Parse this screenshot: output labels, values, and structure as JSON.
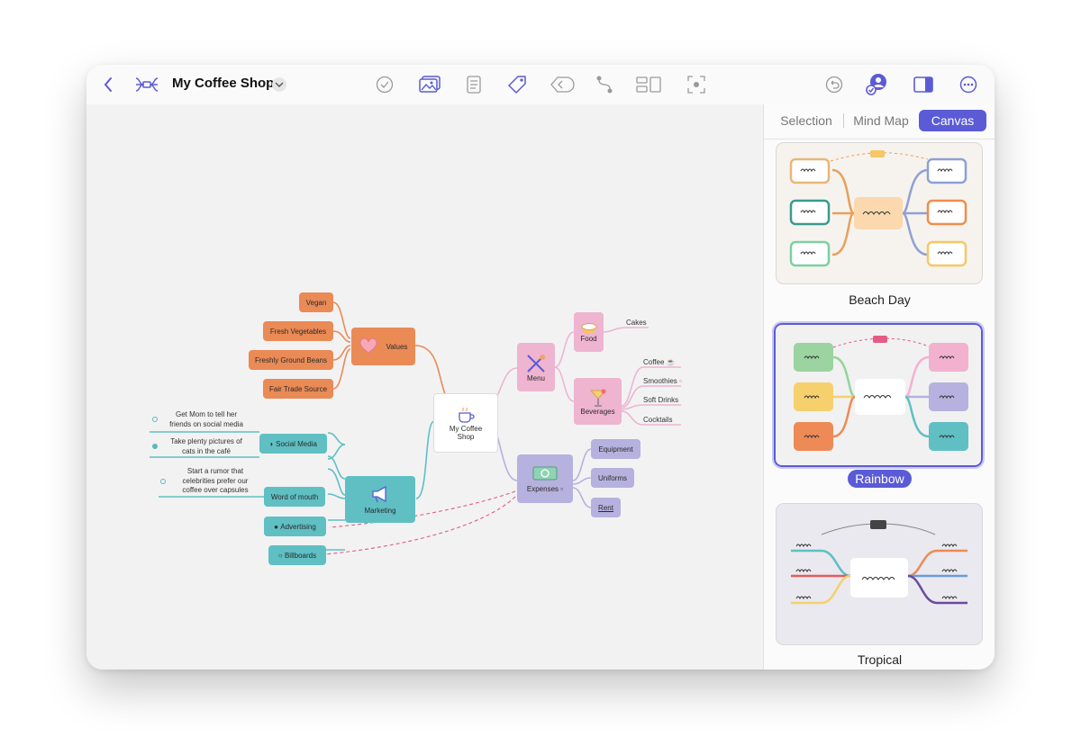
{
  "toolbar": {
    "title": "My Coffee Shop",
    "icons": [
      "back-chevron-icon",
      "map-structure-icon",
      "dropdown-chevron-icon",
      "checkmark-circle-icon",
      "image-icon",
      "document-icon",
      "tag-icon",
      "boundary-icon",
      "relationship-icon",
      "layout-icon",
      "focus-icon",
      "undo-icon",
      "collaboration-icon",
      "sidebar-toggle-icon",
      "more-icon"
    ]
  },
  "panel": {
    "tabs": [
      "Selection",
      "Mind Map",
      "Canvas"
    ],
    "active_tab": "Canvas",
    "themes": [
      "Beach Day",
      "Rainbow",
      "Tropical"
    ],
    "selected_theme": "Rainbow"
  },
  "colors": {
    "accent": "#5b5bd6",
    "values": "#ea8a55",
    "menu": "#eeb4d0",
    "expenses": "#b6b1de",
    "marketing": "#5fbfc3"
  },
  "mindmap": {
    "center": {
      "line1": "My Coffee",
      "line2": "Shop",
      "icon": "coffee-cup-icon"
    },
    "values": {
      "label": "Values",
      "icon": "heart-icon",
      "children": [
        "Vegan",
        "Fresh Vegetables",
        "Freshly Ground Beans",
        "Fair Trade Source"
      ]
    },
    "menu": {
      "label": "Menu",
      "icon": "utensils-icon",
      "food": {
        "label": "Food",
        "icon": "pie-icon",
        "children": [
          "Cakes"
        ]
      },
      "beverages": {
        "label": "Beverages",
        "icon": "cocktail-icon",
        "children": [
          "Coffee",
          "Smoothies",
          "Soft Drinks",
          "Cocktails"
        ]
      }
    },
    "expenses": {
      "label": "Expenses",
      "icon": "money-icon",
      "children": [
        "Equipment",
        "Uniforms",
        "Rent"
      ]
    },
    "marketing": {
      "label": "Marketing",
      "icon": "megaphone-icon",
      "social": {
        "label": "Social Media",
        "notes": [
          "Get Mom to tell her friends on social media",
          "Take plenty pictures of cats in the café"
        ]
      },
      "word_of_mouth": {
        "label": "Word of mouth",
        "notes": [
          "Start a rumor that celebrities prefer our coffee over capsules"
        ]
      },
      "advertising": {
        "label": "Advertising"
      },
      "billboards": {
        "label": "Billboards"
      }
    }
  },
  "notes_split": {
    "mom": [
      "Get Mom to tell her",
      "friends on social media"
    ],
    "cats": [
      "Take plenty pictures of",
      "cats in the café"
    ],
    "rumor": [
      "Start a rumor that",
      "celebrities prefer our",
      "coffee over capsules"
    ]
  }
}
